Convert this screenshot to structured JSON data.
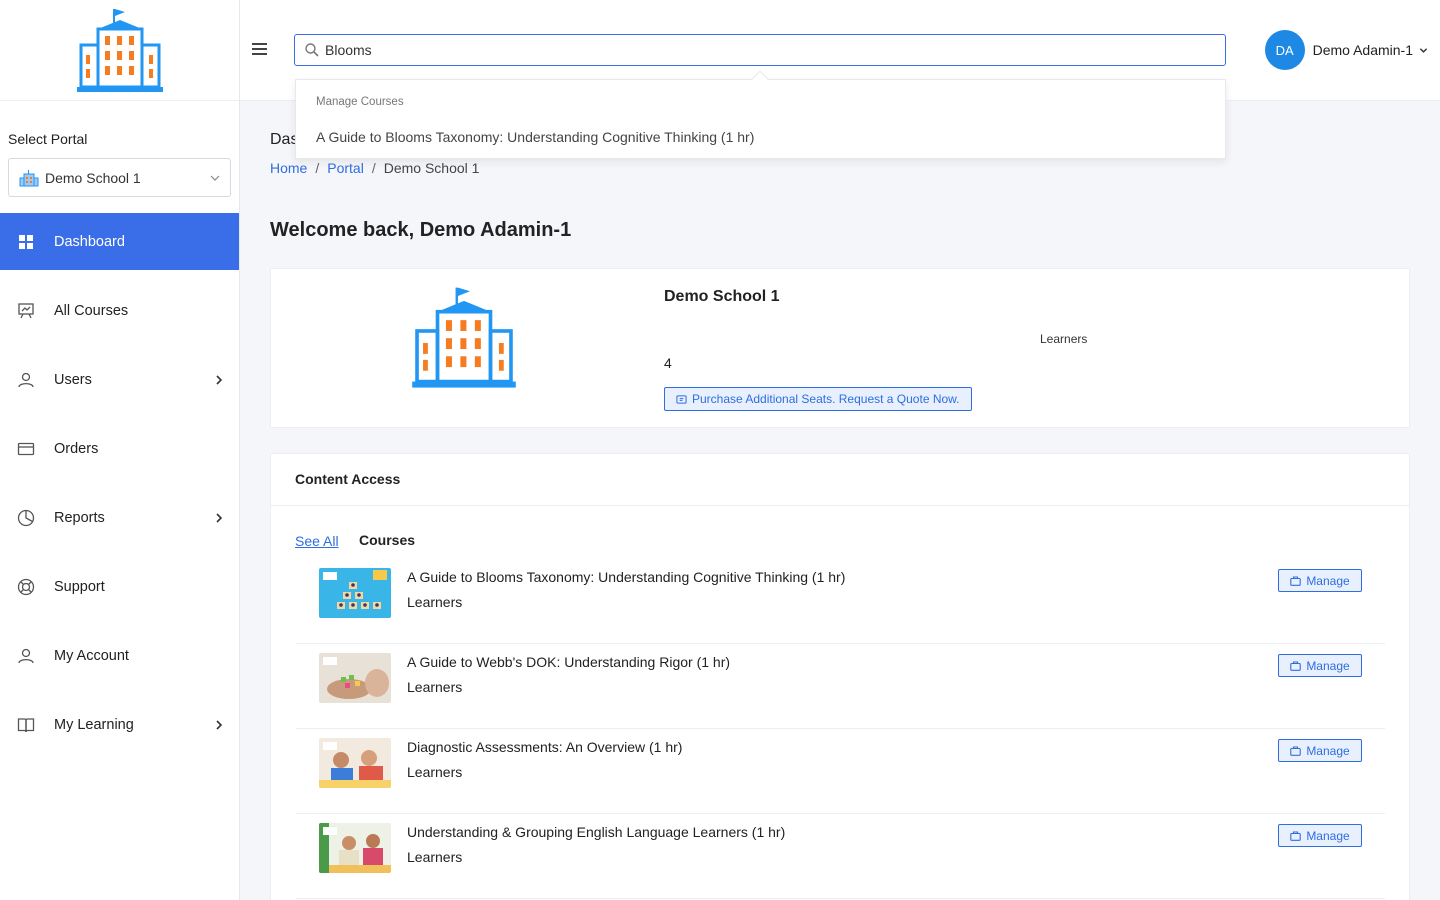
{
  "sidebar": {
    "portal_label": "Select Portal",
    "portal_value": "Demo School 1",
    "items": [
      {
        "label": "Dashboard",
        "icon": "dashboard-icon",
        "active": true
      },
      {
        "label": "All Courses",
        "icon": "presentation-icon"
      },
      {
        "label": "Users",
        "icon": "user-icon",
        "arrow": true
      },
      {
        "label": "Orders",
        "icon": "card-icon"
      },
      {
        "label": "Reports",
        "icon": "pie-chart-icon",
        "arrow": true
      },
      {
        "label": "Support",
        "icon": "lifebuoy-icon"
      },
      {
        "label": "My Account",
        "icon": "user-icon"
      },
      {
        "label": "My Learning",
        "icon": "book-icon",
        "arrow": true
      }
    ]
  },
  "header": {
    "search_value": "Blooms",
    "user_initials": "DA",
    "user_name": "Demo Adamin-1"
  },
  "search_dropdown": {
    "group": "Manage Courses",
    "result": "A Guide to Blooms Taxonomy: Understanding Cognitive Thinking (1 hr)"
  },
  "main": {
    "page_title": "Das",
    "breadcrumb": [
      "Home",
      "Portal",
      "Demo School 1"
    ],
    "welcome": "Welcome back, Demo Adamin-1",
    "school": {
      "name": "Demo School 1",
      "learners_label": "Learners",
      "learners_value": "4",
      "purchase_label": "Purchase Additional Seats. Request a Quote Now."
    },
    "content_access": {
      "title": "Content Access",
      "see_all": "See All",
      "tab": "Courses",
      "manage_label": "Manage",
      "courses": [
        {
          "title": "A Guide to Blooms Taxonomy: Understanding Cognitive Thinking (1 hr)",
          "label": "Learners"
        },
        {
          "title": "A Guide to Webb's DOK: Understanding Rigor (1 hr)",
          "label": "Learners"
        },
        {
          "title": "Diagnostic Assessments: An Overview (1 hr)",
          "label": "Learners"
        },
        {
          "title": "Understanding & Grouping English Language Learners (1 hr)",
          "label": "Learners"
        }
      ]
    }
  },
  "colors": {
    "primary": "#3a6ee8",
    "link": "#2f6de0",
    "avatar": "#1e88e5",
    "school_blue": "#2196f3",
    "school_orange": "#f57c1f"
  }
}
